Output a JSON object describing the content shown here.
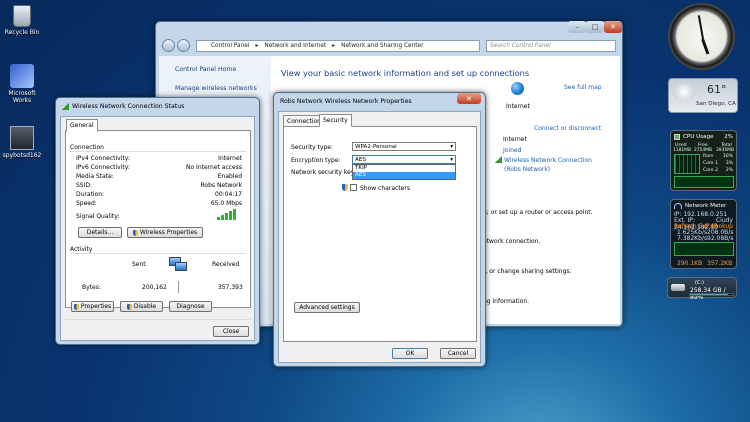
{
  "desktop": {
    "icons": [
      {
        "label": "Recycle Bin"
      },
      {
        "label": "Microsoft Works"
      },
      {
        "label": "spybotsd162"
      }
    ]
  },
  "explorer": {
    "nav": {
      "back": "back",
      "forward": "forward"
    },
    "breadcrumb": [
      "Control Panel",
      "Network and Internet",
      "Network and Sharing Center"
    ],
    "search_placeholder": "Search Control Panel",
    "sidebar": {
      "home": "Control Panel Home",
      "manage": "Manage wireless networks"
    },
    "main": {
      "heading": "View your basic network information and set up connections",
      "see_full_map": "See full map",
      "internet_label": "Internet",
      "connect_disconnect": "Connect or disconnect",
      "access_label": "Internet",
      "connections_label": "Joined",
      "connection_link": "Wireless Network Connection",
      "connection_sub": "(Robs Network)",
      "lines": [
        "n; or set up a router or access point.",
        "etwork connection.",
        "r, or change sharing settings.",
        "ng information."
      ]
    }
  },
  "status": {
    "title": "Wireless Network Connection Status",
    "tab": "General",
    "connection_section": "Connection",
    "rows": [
      {
        "k": "IPv4 Connectivity:",
        "v": "Internet"
      },
      {
        "k": "IPv6 Connectivity:",
        "v": "No Internet access"
      },
      {
        "k": "Media State:",
        "v": "Enabled"
      },
      {
        "k": "SSID:",
        "v": "Robs Network"
      },
      {
        "k": "Duration:",
        "v": "00:04:17"
      },
      {
        "k": "Speed:",
        "v": "65.0 Mbps"
      }
    ],
    "signal_label": "Signal Quality:",
    "signal_bars": 5,
    "details": "Details...",
    "wireless_props": "Wireless Properties",
    "activity_section": "Activity",
    "sent": "Sent",
    "received": "Received",
    "bytes_label": "Bytes:",
    "bytes_sent": "200,162",
    "bytes_received": "357,393",
    "properties": "Properties",
    "disable": "Disable",
    "diagnose": "Diagnose",
    "close": "Close"
  },
  "props": {
    "title": "Robs Network Wireless Network Properties",
    "tabs": [
      "Connection",
      "Security"
    ],
    "security_type_label": "Security type:",
    "security_type_value": "WPA2-Personal",
    "encryption_label": "Encryption type:",
    "encryption_value": "AES",
    "encryption_options": [
      "TKIP",
      "AES"
    ],
    "key_label": "Network security key",
    "show_characters": "Show characters",
    "advanced": "Advanced settings",
    "ok": "OK",
    "cancel": "Cancel"
  },
  "gadgets": {
    "weather": {
      "temp": "61°",
      "city": "San Diego, CA"
    },
    "cpu": {
      "title": "CPU Usage",
      "pct": "2%",
      "cols": [
        "Used",
        "Free",
        "Total"
      ],
      "vals": [
        "1181MB",
        "2754MB",
        "3935MB"
      ],
      "ram_label": "Ram",
      "ram": "30%",
      "core1_label": "Core 1",
      "core1": "3%",
      "core2_label": "Core 2",
      "core2": "2%"
    },
    "netmeter": {
      "title": "Network Meter",
      "ip": "IP: 192.168.0.251",
      "ext": "Ext. IP: 24.161.182.80",
      "city": "Ciudy",
      "refresh": "Refresh Ext. IP",
      "lookup": "IP Lookup",
      "up": "1.625Kb/s",
      "down": "7.382Kb/s",
      "up2": "208.0B/s",
      "down2": "92.08B/s",
      "tot_up": "290.1KB",
      "tot_down": "357.2KB"
    },
    "drive": {
      "label": "(C:)",
      "value": "258.34 GB / 89%"
    }
  }
}
